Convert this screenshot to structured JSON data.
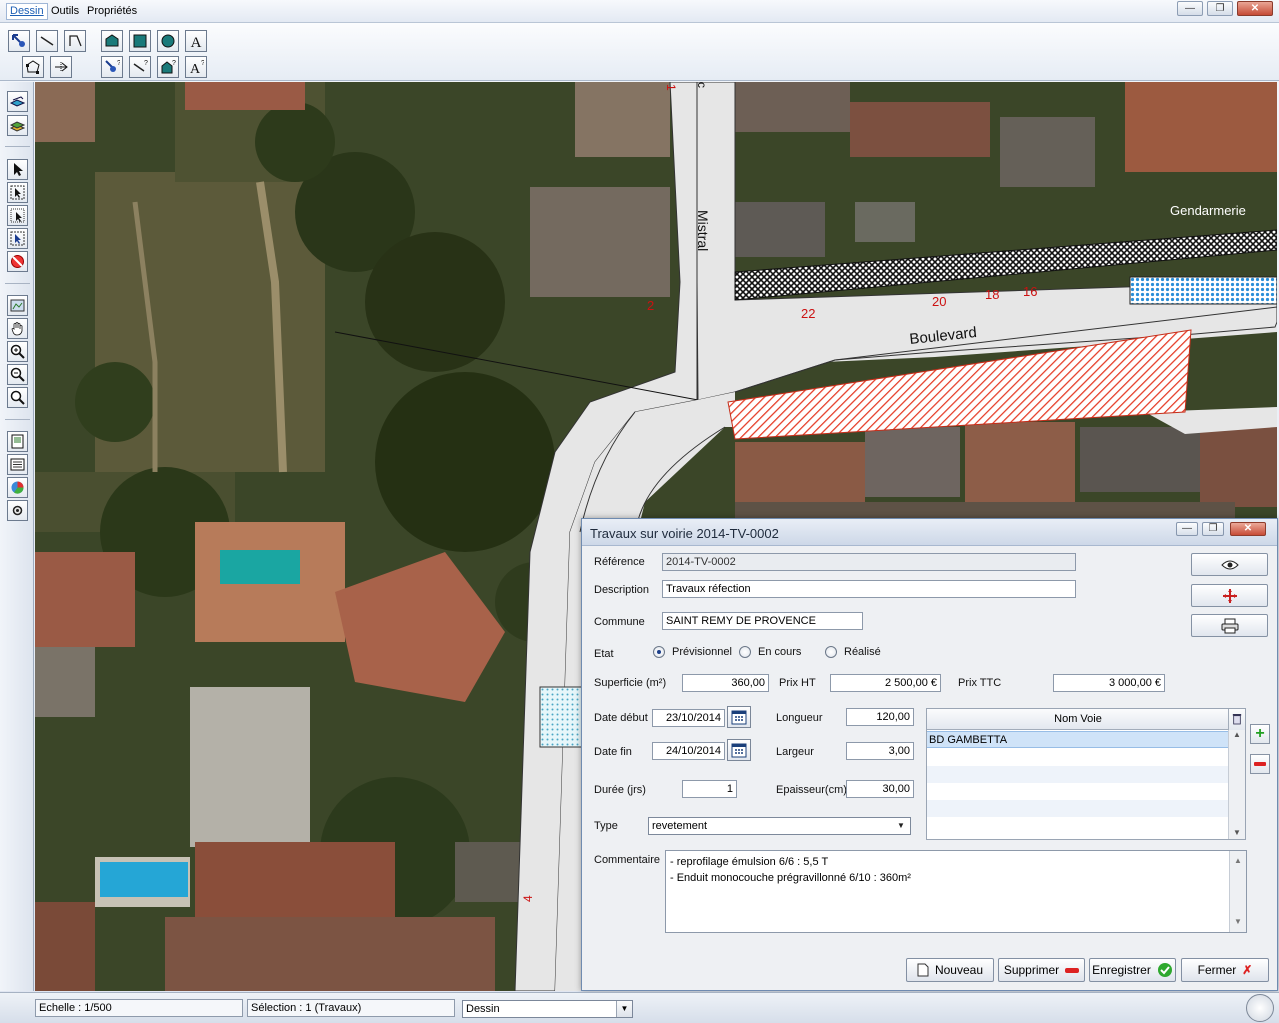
{
  "menubar": {
    "items": [
      "Dessin",
      "Outils",
      "Propriétés"
    ],
    "window_controls": [
      "minimize",
      "restore",
      "close"
    ]
  },
  "toolbar": {
    "row1_icons": [
      "select-arrow-icon",
      "line-icon",
      "polyline-icon",
      "polygon-icon",
      "rectangle-icon",
      "circle-icon",
      "text-icon"
    ],
    "row2_icons": [
      "polygon-edit-icon",
      "node-add-icon",
      "select-edit-icon",
      "line-edit-icon",
      "polygon-edit2-icon",
      "text-edit-icon"
    ]
  },
  "left_toolbar": {
    "icons": [
      "layers-icon",
      "layers-stack-icon",
      "pointer-icon",
      "select-zone-icon",
      "select-rect-icon",
      "select-info-icon",
      "no-select-icon",
      "map-view-icon",
      "pan-hand-icon",
      "zoom-in-icon",
      "zoom-out-icon",
      "zoom-icon",
      "print-icon",
      "list-icon",
      "color-icon",
      "gear-icon"
    ]
  },
  "map": {
    "labels": {
      "mistral": "Mistral",
      "boulevard": "Boulevard",
      "gendarmerie": "Gendarmerie",
      "c_partial": "c",
      "n2": "2",
      "n4": "4",
      "n16": "16",
      "n18": "18",
      "n20": "20",
      "n22": "22",
      "n1": "1"
    },
    "colors": {
      "road": "#e6e6e6",
      "roofs": "#8a6a55",
      "trees": "#2f3d22",
      "hatch_red": "#e53a25",
      "hatch_blue": "#2a8fd8",
      "number_red": "#cc1111"
    }
  },
  "dialog": {
    "title": "Travaux sur voirie 2014-TV-0002",
    "reference_label": "Référence",
    "reference_value": "2014-TV-0002",
    "description_label": "Description",
    "description_value": "Travaux réfection",
    "commune_label": "Commune",
    "commune_value": "SAINT REMY DE PROVENCE",
    "etat_label": "Etat",
    "etat_options": [
      "Prévisionnel",
      "En cours",
      "Réalisé"
    ],
    "etat_selected": "Prévisionnel",
    "superficie_label": "Superficie (m²)",
    "superficie_value": "360,00",
    "prixht_label": "Prix HT",
    "prixht_value": "2 500,00 €",
    "prixttc_label": "Prix TTC",
    "prixttc_value": "3 000,00 €",
    "datedebut_label": "Date début",
    "datedebut_value": "23/10/2014",
    "datefin_label": "Date fin",
    "datefin_value": "24/10/2014",
    "duree_label": "Durée (jrs)",
    "duree_value": "1",
    "longueur_label": "Longueur",
    "longueur_value": "120,00",
    "largeur_label": "Largeur",
    "largeur_value": "3,00",
    "epaisseur_label": "Epaisseur(cm)",
    "epaisseur_value": "30,00",
    "type_label": "Type",
    "type_value": "revetement",
    "voies_header": "Nom Voie",
    "voies_rows": [
      "BD GAMBETTA",
      "",
      "",
      "",
      "",
      ""
    ],
    "commentaire_label": "Commentaire",
    "commentaire_lines": [
      "- reprofilage émulsion 6/6 : 5,5 T",
      "- Enduit monocouche prégravillonné 6/10 : 360m²"
    ],
    "side_buttons": [
      "eye-icon",
      "locate-cross-icon",
      "print-icon"
    ],
    "buttons": {
      "nouveau": "Nouveau",
      "supprimer": "Supprimer",
      "enregistrer": "Enregistrer",
      "fermer": "Fermer"
    }
  },
  "statusbar": {
    "echelle": "Echelle : 1/500",
    "selection": "Sélection : 1 (Travaux)",
    "mode": "Dessin"
  }
}
